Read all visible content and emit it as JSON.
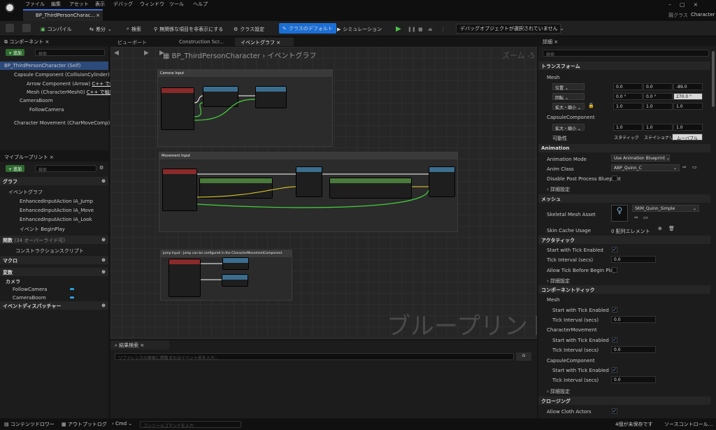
{
  "menu": [
    "ファイル",
    "編集",
    "アセット",
    "表示",
    "デバッグ",
    "ウィンドウ",
    "ツール",
    "ヘルプ"
  ],
  "tab_title": "BP_ThirdPersonCharac...",
  "parent_class_label": "親クラス",
  "parent_class_value": "Character",
  "toolbar": {
    "compile": "コンパイル",
    "diff": "差分",
    "find": "検索",
    "hide_unrelated": "無関係な項目を非表示にする",
    "class_settings": "クラス設定",
    "class_defaults": "クラスのデフォルト",
    "simulation": "シミュレーション",
    "debug_object": "デバッグオブジェクトが選択されていません"
  },
  "components": {
    "title": "コンポーネント",
    "add": "+ 追加",
    "search_placeholder": "検索",
    "items": [
      "BP_ThirdPersonCharacter (Self)",
      "Capsule Component (CollisionCylinder)",
      "Arrow Component (Arrow)",
      "Mesh (CharacterMesh0)",
      "CameraBoom",
      "FollowCamera",
      "Character Movement (CharMoveComp)"
    ],
    "cpp_edit": "C++ で編集"
  },
  "my_blueprint": {
    "title": "マイブループリント",
    "add": "+ 追加",
    "search_placeholder": "検索",
    "graphs_header": "グラフ",
    "event_graph": "イベントグラフ",
    "graph_items": [
      "EnhancedInputAction IA_Jump",
      "EnhancedInputAction IA_Move",
      "EnhancedInputAction IA_Look",
      "イベント BeginPlay"
    ],
    "functions_header": "関数",
    "functions_count": "(34 オーバーライド可)",
    "construction_script": "コンストラクションスクリプト",
    "macros_header": "マクロ",
    "variables_header": "変数",
    "camera_category": "カメラ",
    "variables": [
      "FollowCamera",
      "CameraBoom"
    ],
    "dispatchers_header": "イベントディスパッチャー"
  },
  "graph_tabs": [
    "ビューポート",
    "Construction Scr...",
    "イベントグラフ"
  ],
  "breadcrumb_bp": "BP_ThirdPersonCharacter",
  "breadcrumb_graph": "イベントグラフ",
  "zoom": "ズーム -5",
  "watermark": "ブループリント",
  "comments": [
    "Camera Input",
    "Movement Input",
    "Jump Input - Jump can be configured in the CharacterMovementComponent"
  ],
  "find_results": {
    "title": "結果検索",
    "placeholder": "リファレンスの検索に関数またはイベント名を入力..."
  },
  "details": {
    "title": "詳細",
    "search_placeholder": "検索",
    "transform_header": "トランスフォーム",
    "mesh_label": "Mesh",
    "location_label": "位置",
    "rotation_label": "回転",
    "scale_label": "拡大・縮小",
    "location": [
      "0.0",
      "0.0",
      "-89.0"
    ],
    "rotation": [
      "0.0 °",
      "0.0 °",
      "270.0 °"
    ],
    "scale": [
      "1.0",
      "1.0",
      "1.0"
    ],
    "capsule_label": "CapsuleComponent",
    "capsule_scale": [
      "1.0",
      "1.0",
      "1.0"
    ],
    "mobility_label": "可動性",
    "mobility_options": [
      "スタティック",
      "ステイショナリ",
      "ムーバブル"
    ],
    "animation_header": "Animation",
    "anim_mode_label": "Animation Mode",
    "anim_mode_value": "Use Animation Blueprint",
    "anim_class_label": "Anim Class",
    "anim_class_value": "ABP_Quinn_C",
    "disable_post_label": "Disable Post Process Blueprint",
    "advanced_label": "詳細設定",
    "mesh_header": "メッシュ",
    "skeletal_mesh_label": "Skeletal Mesh Asset",
    "skeletal_mesh_value": "SKM_Quinn_Simple",
    "skin_cache_label": "Skin Cache Usage",
    "skin_cache_value": "0 配列エレメント",
    "activation_header": "アクタティック",
    "start_tick_label": "Start with Tick Enabled",
    "tick_interval_label": "Tick Interval (secs)",
    "tick_interval_value": "0.0",
    "allow_tick_label": "Allow Tick Before Begin Play",
    "component_tick_header": "コンポーネントティック",
    "sub_mesh": "Mesh",
    "sub_charmove": "CharacterMovement",
    "sub_capsule": "CapsuleComponent",
    "clothing_header": "クロージング",
    "allow_cloth_label": "Allow Cloth Actors"
  },
  "statusbar": {
    "content_drawer": "コンテンツドロワー",
    "output_log": "アウトプットログ",
    "cmd": "Cmd",
    "console_placeholder": "コンソールコマンドを入力",
    "unsaved": "4個が未保存です",
    "source_control": "ソースコントロール..."
  }
}
